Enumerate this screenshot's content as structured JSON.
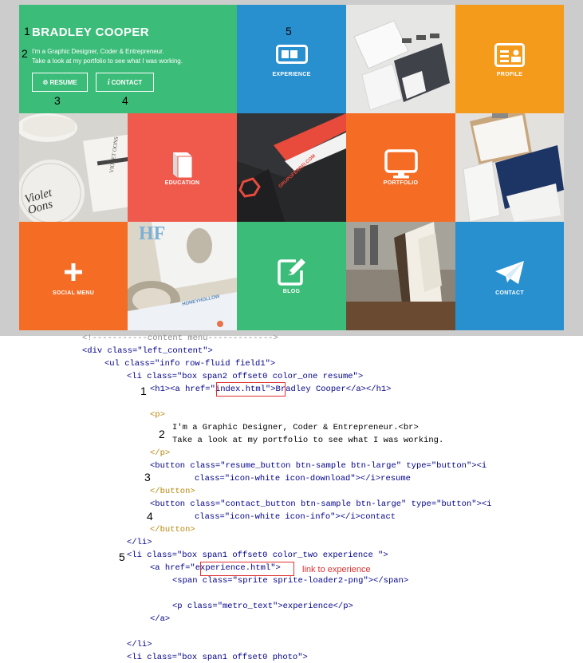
{
  "hero": {
    "title": "BRADLEY COOPER",
    "line1": "I'm a Graphic Designer, Coder & Entrepreneur.",
    "line2": "Take a look at my portfolio to see what I was working.",
    "resume_label": "RESUME",
    "contact_label": "CONTACT"
  },
  "markers": [
    "1",
    "2",
    "3",
    "4",
    "5"
  ],
  "tiles": {
    "experience": "EXPERIENCE",
    "profile": "PROFILE",
    "education": "EDUCATION",
    "portfolio": "PORTFOLIO",
    "social_menu": "SOCIAL MENU",
    "blog": "BLOG",
    "contact": "CONTACT"
  },
  "photos": {
    "violet_text": "Violet Oons",
    "violet_small": "VIOLET OONS",
    "grupo_text": "GRUPOFERREI.COM",
    "hf_text": "HF",
    "honey_text": "HONEYHOLLOW"
  },
  "colors": {
    "green": "#3cbc79",
    "blue": "#2990d0",
    "orange": "#f59b1b",
    "red": "#ef5a4c",
    "orange2": "#f56c25"
  },
  "code": {
    "comment": "<!-----------content menu------------->",
    "div_open": "<div class=\"left_content\">",
    "ul_open": "<ul class=\"info row-fluid field1\">",
    "li_resume": "<li class=\"box span2 offset0 color_one resume\">",
    "h1_a": "<h1><a href=",
    "h1_href": "\"index.html\"",
    "h1_close": ">Bradley Cooper</a></h1>",
    "p_open": "<p>",
    "p_line1": "I'm a Graphic Designer, Coder & Entrepreneur.<br>",
    "p_line2": "Take a look at my portfolio to see what I was working.",
    "p_close": "</p>",
    "btn1_a": "<button class=\"resume_button btn-sample btn-large\" type=\"button\"><i",
    "btn1_b": "class=\"icon-white icon-download\"></i>resume",
    "btn_close": "</button>",
    "btn2_a": "<button class=\"contact_button btn-sample btn-large\" type=\"button\"><i",
    "btn2_b": "class=\"icon-white icon-info\"></i>contact",
    "li_close": "</li>",
    "li_exp": "<li class=\"box span1 offset0 color_two experience \">",
    "a_open": "<a href=",
    "a_href": "\"experience.html\"",
    "a_gt": ">",
    "link_note": "link to experience",
    "span_sprite": "<span class=\"sprite sprite-loader2-png\"></span>",
    "p_metro": "<p class=\"metro_text\">experience</p>",
    "a_close": "</a>",
    "li_close2": "</li>",
    "li_photo": "<li class=\"box span1 offset0 photo\">"
  }
}
